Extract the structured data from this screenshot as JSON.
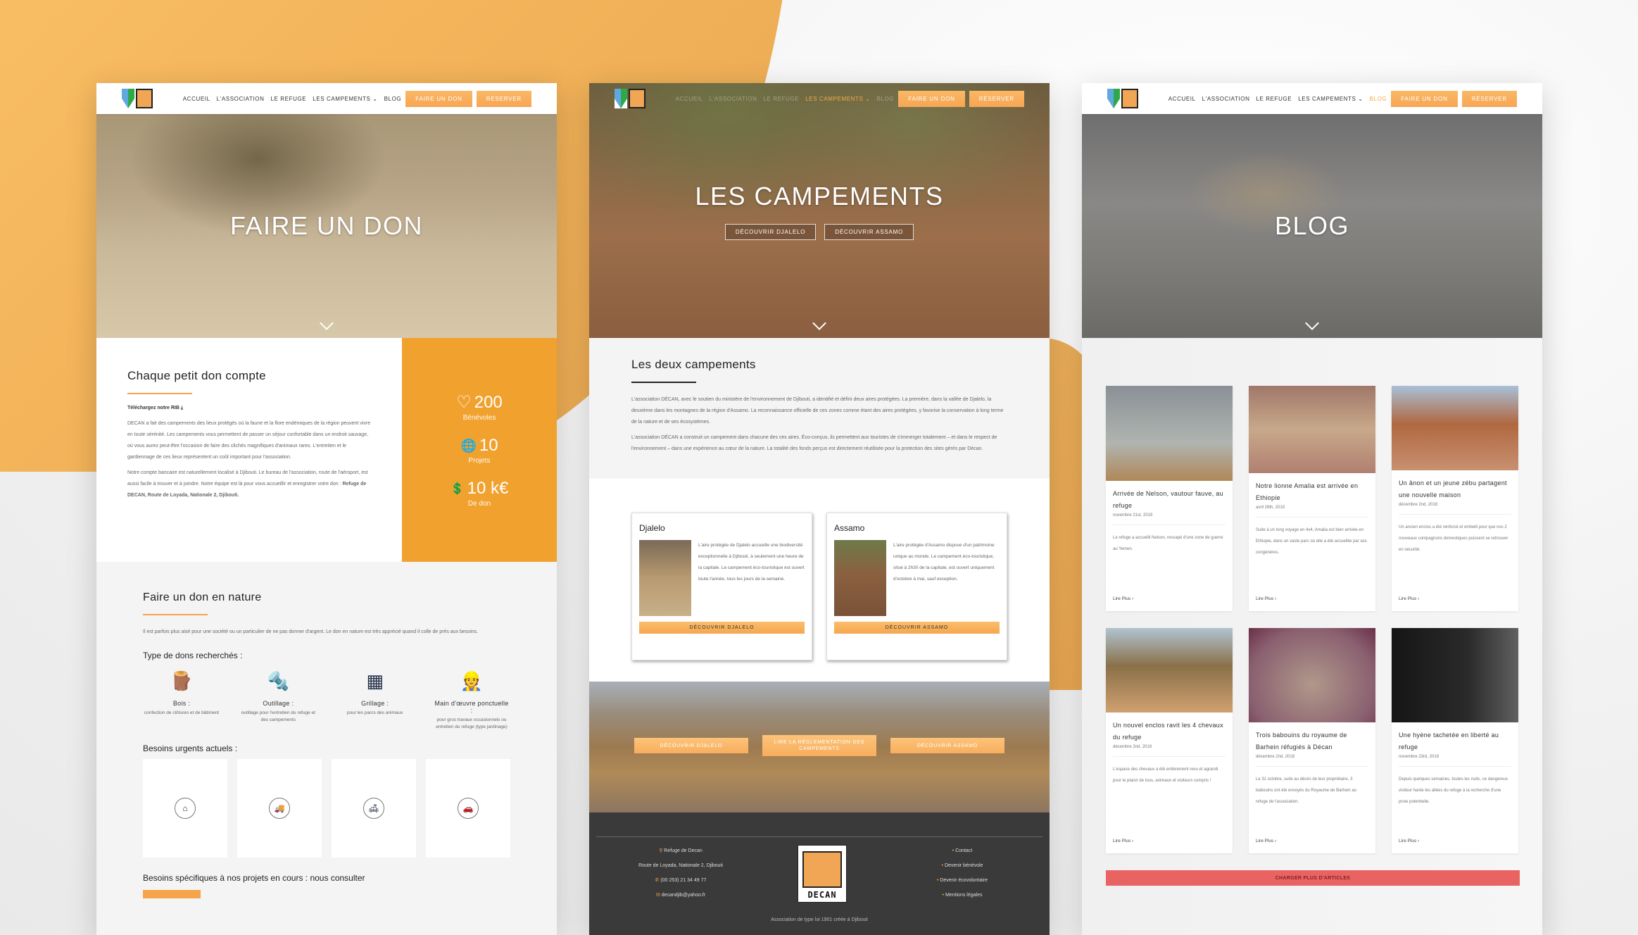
{
  "colors": {
    "accent": "#f6a44a",
    "stats_bg": "#f1a12e",
    "footer_bg": "#3a3a3a",
    "load_more": "#ea6363"
  },
  "nav": {
    "items": [
      "ACCUEIL",
      "L'ASSOCIATION",
      "LE REFUGE",
      "LES CAMPEMENTS ⌄",
      "BLOG"
    ],
    "donate_button": "FAIRE UN DON",
    "reserve_button": "RÉSERVER"
  },
  "panel1": {
    "hero_title": "FAIRE UN DON",
    "section_title": "Chaque petit don compte",
    "rib_link": "Téléchargez notre RIB",
    "paragraph1": "DECAN a fait des campements des lieux protégés où la faune et la flore endémiques de la région peuvent vivre en toute sérénité. Les campements vous permettent de passer un séjour confortable dans un endroit sauvage, où vous aurez peut-être l'occasion de faire des clichés magnifiques d'animaux rares. L'entretien et le gardiennage de ces lieux représentent un coût important pour l'association.",
    "paragraph2_start": "Notre compte bancaire est naturellement localisé à Djibouti. Le bureau de l'association, route de l'aéroport, est aussi facile à trouver et à joindre. Notre équipe est là pour vous accueillir et enregistrer votre don : ",
    "paragraph2_bold": "Refuge de DECAN, Route de Loyada, Nationale 2, Djibouti.",
    "stats": [
      {
        "icon": "heart-icon",
        "glyph": "♡",
        "value": "200",
        "label": "Bénévoles"
      },
      {
        "icon": "globe-icon",
        "glyph": "🌐",
        "value": "10",
        "label": "Projets"
      },
      {
        "icon": "donation-hand-icon",
        "glyph": "💲",
        "value": "10 k€",
        "label": "De don"
      }
    ],
    "nature_title": "Faire un don en nature",
    "nature_text": "Il est parfois plus aisé pour une société ou un particulier de ne pas donner d'argent. Le don en nature est très apprécié quand il colle de près aux besoins.",
    "types_title": "Type de dons recherchés :",
    "types": [
      {
        "icon": "logs-icon",
        "glyph": "🪵",
        "title": "Bois :",
        "desc": "confection de clôtures et de bâtiment"
      },
      {
        "icon": "nails-tools-icon",
        "glyph": "🔩",
        "title": "Outillage :",
        "desc": "outillage pour l'entretien du refuge et des campements"
      },
      {
        "icon": "fence-icon",
        "glyph": "▦",
        "title": "Grillage :",
        "desc": "pour les parcs des animaux"
      },
      {
        "icon": "worker-icon",
        "glyph": "👷",
        "title": "Main d'œuvre ponctuelle :",
        "desc": "pour gros travaux occasionnels ou entretien du refuge (type jardinage)"
      }
    ],
    "urgent_title": "Besoins urgents actuels :",
    "urgent": [
      {
        "icon": "home-icon",
        "glyph": "⌂"
      },
      {
        "icon": "truck-icon",
        "glyph": "🚚"
      },
      {
        "icon": "sofa-icon",
        "glyph": "🛋"
      },
      {
        "icon": "car-icon",
        "glyph": "🚗"
      }
    ],
    "specific_title": "Besoins spécifiques à nos projets en cours : nous consulter"
  },
  "panel2": {
    "hero_title": "LES CAMPEMENTS",
    "hero_btn1": "DÉCOUVRIR DJALELO",
    "hero_btn2": "DÉCOUVRIR ASSAMO",
    "intro_title": "Les deux campements",
    "intro_p1": "L'association DÉCAN, avec le soutien du ministère de l'environnement de Djibouti, a identifié et défini deux aires protégées. La première, dans la vallée de Djalelo, la deuxième dans les montagnes de la région d'Assamo. La reconnaissance officielle de ces zones comme étant des aires protégées, y favorise la conservation à long terme de la nature et de ses écosystèmes.",
    "intro_p2": "L'association DÉCAN a construit un campement dans chacune des ces aires. Éco-conçus, ils permettent aux touristes de s'immerger totalement – et dans le respect de l'environnement – dans une expérience au cœur de la nature. La totalité des fonds perçus est directement réutilisée pour la protection des sites gérés par Décan.",
    "cards": [
      {
        "title": "Djalelo",
        "text": "L'aire protégée de Djalelo accueille une biodiversité exceptionnelle à Djibouti, à seulement une heure de la capitale. Le campement éco-touristique est ouvert toute l'année, tous les jours de la semaine.",
        "button": "DÉCOUVRIR DJALELO"
      },
      {
        "title": "Assamo",
        "text": "L'aire protégée d'Assamo dispose d'un patrimoine unique au monde. Le campement éco-touristique, situé à 2h30 de la capitale, est ouvert uniquement d'octobre à mai, sauf exception.",
        "button": "DÉCOUVRIR ASSAMO"
      }
    ],
    "landscape_buttons": [
      "DÉCOUVRIR DJALELO",
      "LIRE LA RÉGLEMENTATION DES CAMPEMENTS",
      "DÉCOUVRIR ASSAMO"
    ],
    "footer": {
      "place": "Refuge de Decan",
      "address": "Route de Loyada, Nationale 2, Djibouti",
      "phone": "(00 253) 21 34 49 77",
      "email": "decandjib@yahoo.fr",
      "logo_text": "DECAN",
      "links": [
        "Contact",
        "Devenir bénévole",
        "Devenir écovolontaire",
        "Mentions légales"
      ],
      "copyright": "Association de type loi 1901 créée à Djibouti"
    }
  },
  "panel3": {
    "hero_title": "BLOG",
    "posts": [
      {
        "title": "Arrivée de Nelson, vautour fauve, au refuge",
        "date": "novembre 21st, 2019",
        "excerpt": "Le refuge a accueilli Nelson, rescapé d'une zone de guerre au Yemen.",
        "more": "Lire Plus ›"
      },
      {
        "title": "Notre lionne Amalia est arrivée en Ethiopie",
        "date": "avril 26th, 2019",
        "excerpt": "Suite à un long voyage en 4x4, Amalia est bien arrivée en Ethiopie, dans un vaste parc où elle a été accueillie par ses congénères.",
        "more": "Lire Plus ›"
      },
      {
        "title": "Un ânon et un jeune zébu partagent une nouvelle maison",
        "date": "décembre 2nd, 2018",
        "excerpt": "Un ancien enclos a été renforcé et embelli pour que nos 2 nouveaux compagnons domestiques puissent se retrouver en sécurité.",
        "more": "Lire Plus ›"
      },
      {
        "title": "Un nouvel enclos ravit les 4 chevaux du refuge",
        "date": "décembre 2nd, 2018",
        "excerpt": "L'espace des chevaux a été entièrement revu et agrandi pour le plaisir de tous, animaux et visiteurs compris !",
        "more": "Lire Plus ›"
      },
      {
        "title": "Trois babouins du royaume de Barhein réfugiés à Décan",
        "date": "décembre 2nd, 2018",
        "excerpt": "Le 31 octobre, suite au décès de leur propriétaire, 3 babouins ont été envoyés du Royaume de Barhein au refuge de l'association.",
        "more": "Lire Plus ›"
      },
      {
        "title": "Une hyène tachetée en liberté au refuge",
        "date": "novembre 23rd, 2018",
        "excerpt": "Depuis quelques semaines, toutes les nuits, ce dangereux visiteur hante les allées du refuge à la recherche d'une proie potentielle.",
        "more": "Lire Plus ›"
      }
    ],
    "load_more": "CHARGER PLUS D'ARTICLES"
  }
}
